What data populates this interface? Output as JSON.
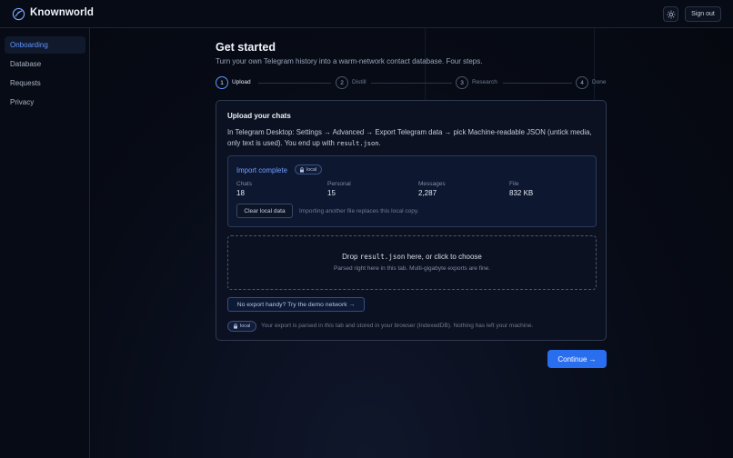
{
  "app": {
    "name": "Knownworld"
  },
  "header": {
    "theme_icon": "sun-icon",
    "signout_label": "Sign out"
  },
  "sidebar": {
    "items": [
      {
        "label": "Onboarding",
        "active": true
      },
      {
        "label": "Database",
        "active": false
      },
      {
        "label": "Requests",
        "active": false
      },
      {
        "label": "Privacy",
        "active": false
      }
    ]
  },
  "page": {
    "title": "Get started",
    "subtitle": "Turn your own Telegram history into a warm-network contact database. Four steps."
  },
  "steps": [
    {
      "number": "1",
      "label": "Upload",
      "active": true
    },
    {
      "number": "2",
      "label": "Distill",
      "active": false
    },
    {
      "number": "3",
      "label": "Research",
      "active": false
    },
    {
      "number": "4",
      "label": "Done",
      "active": false
    }
  ],
  "card": {
    "title": "Upload your chats",
    "instructions_prefix": "In Telegram Desktop: Settings → Advanced → Export Telegram data → pick Machine-readable JSON (untick media, only text is used). You end up with ",
    "instructions_file": "result.json",
    "instructions_suffix": ".",
    "import": {
      "title": "Import complete",
      "badge": "local",
      "stats": [
        {
          "label": "Chats",
          "value": "18"
        },
        {
          "label": "Personal",
          "value": "15"
        },
        {
          "label": "Messages",
          "value": "2,287"
        },
        {
          "label": "File",
          "value": "832 KB"
        }
      ],
      "clear_label": "Clear local data",
      "clear_hint": "Importing another file replaces this local copy."
    },
    "dropzone": {
      "prefix": "Drop ",
      "file": "result.json",
      "suffix": " here, or click to choose",
      "sub": "Parsed right here in this tab. Multi-gigabyte exports are fine."
    },
    "demo_label": "No export handy? Try the demo network →",
    "footer_badge": "local",
    "footer_note": "Your export is parsed in this tab and stored in your browser (IndexedDB). Nothing has left your machine."
  },
  "continue_label": "Continue →",
  "colors": {
    "accent": "#2a6ef0",
    "active_nav": "#5f95ff",
    "background": "#070b15"
  }
}
